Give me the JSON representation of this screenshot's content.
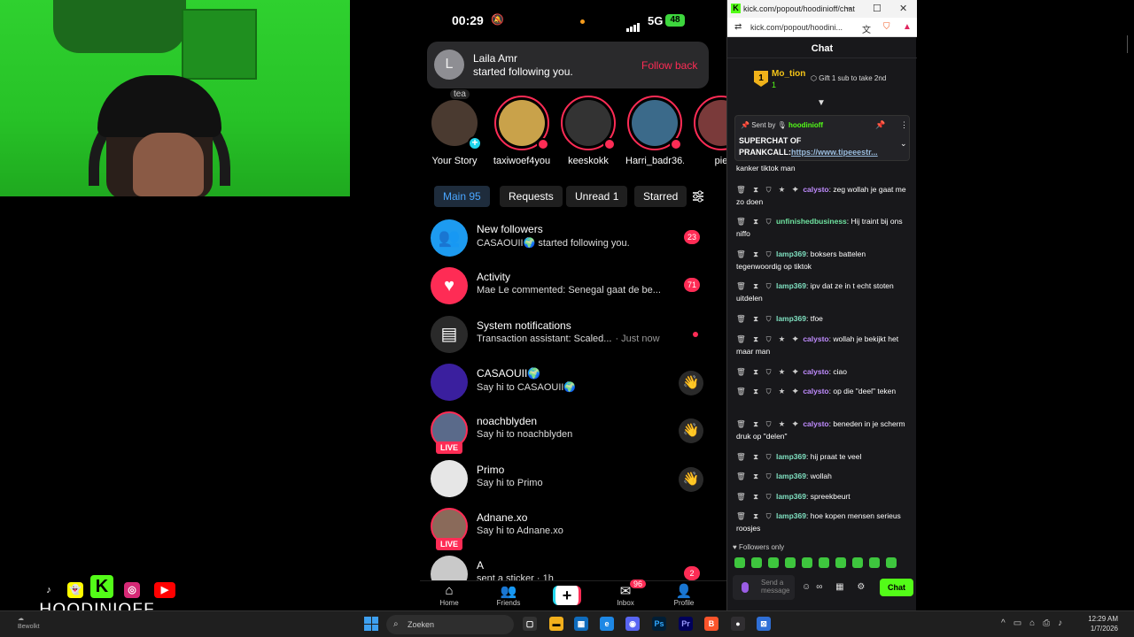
{
  "phone": {
    "status": {
      "time": "00:29",
      "network": "5G",
      "battery": "48"
    },
    "notification": {
      "avatar_letter": "L",
      "name": "Laila Amr",
      "message": "started following you.",
      "action": "Follow back",
      "note": "tea"
    },
    "stories": [
      {
        "label": "Your Story",
        "own": true,
        "color": "#4a3a30"
      },
      {
        "label": "taxiwoef4you",
        "own": false,
        "color": "#c9a24a"
      },
      {
        "label": "keeskokk",
        "own": false,
        "color": "#333333"
      },
      {
        "label": "Harri_badr36...",
        "own": false,
        "color": "#3b6a8a"
      },
      {
        "label": "pie",
        "own": false,
        "color": "#7a3a3a"
      }
    ],
    "tabs": [
      "Main 95",
      "Requests",
      "Unread 1",
      "Starred"
    ],
    "rows": [
      {
        "title": "New followers",
        "sub": "CASAOUII🌍 started following you.",
        "badge": "23",
        "avatar": "#1d9bf0",
        "icon": "followers-icon"
      },
      {
        "title": "Activity",
        "sub": "Mae Le commented: Senegal gaat de be...",
        "badge": "71",
        "avatar": "#fe2c55",
        "icon": "heart-icon"
      },
      {
        "title": "System notifications",
        "sub": "Transaction assistant: Scaled...",
        "time": "· Just now",
        "avatar": "#2a2a2a",
        "icon": "inbox-icon"
      },
      {
        "title": "CASAOUII🌍",
        "sub": "Say hi to CASAOUII🌍",
        "avatar": "#3a1f9e",
        "wave": "👋"
      },
      {
        "title": "noachblyden",
        "sub": "Say hi to noachblyden",
        "avatar": "#5a6a8a",
        "wave": "👋",
        "live": "LIVE"
      },
      {
        "title": "Primo",
        "sub": "Say hi to Primo",
        "avatar": "#e6e6e6",
        "wave": "👋"
      },
      {
        "title": "Adnane.xo",
        "sub": "Say hi to Adnane.xo",
        "avatar": "#8a6a5a",
        "live": "LIVE"
      },
      {
        "title": "A",
        "sub": "sent a sticker · 1h",
        "badge": "2",
        "avatar": "#c9c9c9"
      }
    ],
    "nav": {
      "home": "Home",
      "friends": "Friends",
      "inbox": "Inbox",
      "inbox_badge": "96",
      "profile": "Profile"
    }
  },
  "browser": {
    "title": "kick.com/popout/hoodinioff/chat",
    "url": "kick.com/popout/hoodini...",
    "chat_title": "Chat",
    "gifter": {
      "rank": "1",
      "name": "Mo_tion",
      "count": "1",
      "gift_text": "Gift 1 sub to take 2nd"
    },
    "pinned": {
      "sent_by": "Sent by",
      "user": "hoodinioff",
      "text": "SUPERCHAT OF PRANKCALL:",
      "link": "https://www.tipeeestr..."
    },
    "messages": [
      {
        "icons": "",
        "user": "",
        "text": "kanker tiktok man",
        "color": "#ffffff"
      },
      {
        "icons": "🗑 ⧗ ⛉ ★ ✦",
        "user": "calysto",
        "text": "zeg wollah je gaat me zo doen",
        "color": "#c08cff"
      },
      {
        "icons": "🗑 ⧗ ⛉",
        "user": "unfinishedbusiness",
        "text": "Hij traint bij ons niffo",
        "color": "#6fe3a0"
      },
      {
        "icons": "🗑 ⧗ ⛉",
        "user": "lamp369",
        "text": "boksers battelen tegenwoordig op tiktok",
        "color": "#7fe0c0"
      },
      {
        "icons": "🗑 ⧗ ⛉",
        "user": "lamp369",
        "text": "ipv dat ze in t echt stoten uitdelen",
        "color": "#7fe0c0"
      },
      {
        "icons": "🗑 ⧗ ⛉",
        "user": "lamp369",
        "text": "tfoe",
        "color": "#7fe0c0"
      },
      {
        "icons": "🗑 ⧗ ⛉ ★ ✦",
        "user": "calysto",
        "text": "wollah je bekijkt het maar man",
        "color": "#c08cff"
      },
      {
        "icons": "🗑 ⧗ ⛉ ★ ✦",
        "user": "calysto",
        "text": "ciao",
        "color": "#c08cff"
      },
      {
        "icons": "🗑 ⧗ ⛉ ★ ✦",
        "user": "calysto",
        "text": "op die \"deel\" teken",
        "color": "#c08cff"
      },
      {
        "icons": "🗑 ⧗ ⛉ ★ ✦",
        "user": "calysto",
        "text": "beneden in je scherm druk op \"delen\"",
        "color": "#c08cff"
      },
      {
        "icons": "🗑 ⧗ ⛉",
        "user": "lamp369",
        "text": "hij praat te veel",
        "color": "#7fe0c0"
      },
      {
        "icons": "🗑 ⧗ ⛉",
        "user": "lamp369",
        "text": "wollah",
        "color": "#7fe0c0"
      },
      {
        "icons": "🗑 ⧗ ⛉",
        "user": "lamp369",
        "text": "spreekbeurt",
        "color": "#7fe0c0"
      },
      {
        "icons": "🗑 ⧗ ⛉",
        "user": "lamp369",
        "text": "hoe kopen mensen serieus roosjes",
        "color": "#7fe0c0"
      }
    ],
    "followers_only": "Followers only",
    "input_placeholder": "Send a message",
    "send_label": "Chat"
  },
  "overlay": {
    "brand": "HOODINIOFF"
  },
  "taskbar": {
    "weather": "Bewolkt",
    "search_placeholder": "Zoeken",
    "time": "12:29 AM",
    "date": "1/7/2026"
  },
  "colors": {
    "kick_green": "#53fc18",
    "tiktok_red": "#fe2c55",
    "tiktok_cyan": "#20d5ec"
  }
}
